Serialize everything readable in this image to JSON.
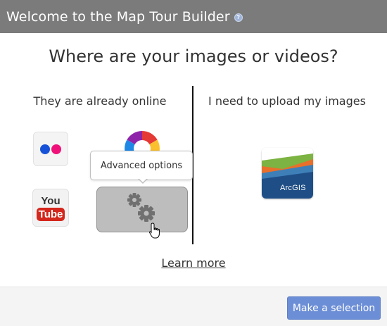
{
  "dialog": {
    "title": "Welcome to the Map Tour Builder",
    "help_icon_glyph": "?"
  },
  "main": {
    "question": "Where are your images or videos?",
    "left_heading": "They are already online",
    "right_heading": "I need to upload my images",
    "learn_more": "Learn more"
  },
  "sources": {
    "flickr": {
      "icon": "flickr-icon"
    },
    "picasa": {
      "icon": "picasa-icon"
    },
    "youtube": {
      "icon": "youtube-icon",
      "word_you": "You",
      "word_tube": "Tube"
    },
    "advanced": {
      "icon": "gear-icon",
      "tooltip": "Advanced options"
    },
    "arcgis": {
      "icon": "arcgis-icon",
      "label": "ArcGIS"
    }
  },
  "footer": {
    "make_selection": "Make a selection"
  },
  "colors": {
    "titlebar": "#7b7b7b",
    "primary_button": "#6c8ed6",
    "advanced_tile": "#bdbdbd"
  }
}
